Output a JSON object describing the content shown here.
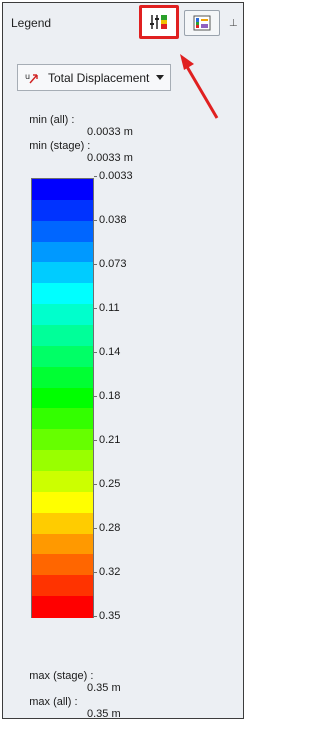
{
  "panel": {
    "title": "Legend"
  },
  "toolbar": {
    "settings_icon": "legend-settings-icon",
    "image_icon": "legend-image-icon",
    "pin_icon": "pin-icon",
    "pin_glyph": "⊥"
  },
  "dropdown": {
    "icon": "displacement-icon",
    "icon_text": "u",
    "selected": "Total Displacement"
  },
  "stats": {
    "min_all_label": "min (all) :",
    "min_all_value": "0.0033 m",
    "min_stage_label": "min (stage) :",
    "min_stage_value": "0.0033 m",
    "max_stage_label": "max (stage) :",
    "max_stage_value": "0.35 m",
    "max_all_label": "max (all) :",
    "max_all_value": "0.35 m"
  },
  "scale": {
    "labels": [
      "0.0033",
      "0.038",
      "0.073",
      "0.11",
      "0.14",
      "0.18",
      "0.21",
      "0.25",
      "0.28",
      "0.32",
      "0.35"
    ],
    "colors": [
      "#0000ff",
      "#0033ff",
      "#0066ff",
      "#0099ff",
      "#00ccff",
      "#00ffff",
      "#00ffcc",
      "#00ff99",
      "#00ff66",
      "#00ff33",
      "#00ff00",
      "#33ff00",
      "#66ff00",
      "#99ff00",
      "#ccff00",
      "#ffff00",
      "#ffcc00",
      "#ff9900",
      "#ff6600",
      "#ff3300",
      "#ff0000"
    ]
  },
  "colors": {
    "highlight": "#e02020",
    "panel_bg": "#eceff3"
  }
}
